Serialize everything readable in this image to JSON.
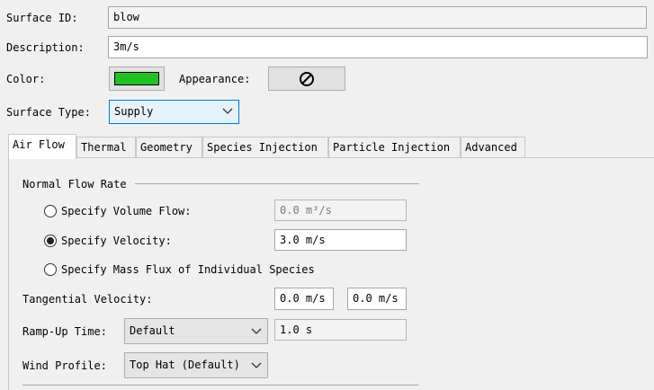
{
  "surface_id": {
    "label": "Surface ID:",
    "value": "blow"
  },
  "description": {
    "label": "Description:",
    "value": "3m/s"
  },
  "color": {
    "label": "Color:",
    "swatch_color": "#22c122"
  },
  "appearance": {
    "label": "Appearance:",
    "button_icon": "no-symbol-icon"
  },
  "surface_type": {
    "label": "Surface Type:",
    "value": "Supply"
  },
  "tabs": [
    {
      "label": "Air Flow"
    },
    {
      "label": "Thermal"
    },
    {
      "label": "Geometry"
    },
    {
      "label": "Species Injection"
    },
    {
      "label": "Particle Injection"
    },
    {
      "label": "Advanced"
    }
  ],
  "air_flow": {
    "group_title": "Normal Flow Rate",
    "options": [
      {
        "label": "Specify Volume Flow:",
        "value": "0.0 m³/s",
        "selected": false
      },
      {
        "label": "Specify Velocity:",
        "value": "3.0 m/s",
        "selected": true
      },
      {
        "label": "Specify Mass Flux of Individual Species",
        "selected": false
      }
    ],
    "tangential": {
      "label": "Tangential Velocity:",
      "value1": "0.0 m/s",
      "value2": "0.0 m/s"
    },
    "ramp_up": {
      "label": "Ramp-Up Time:",
      "select": "Default",
      "value": "1.0 s"
    },
    "wind_profile": {
      "label": "Wind Profile:",
      "select": "Top Hat (Default)"
    }
  }
}
